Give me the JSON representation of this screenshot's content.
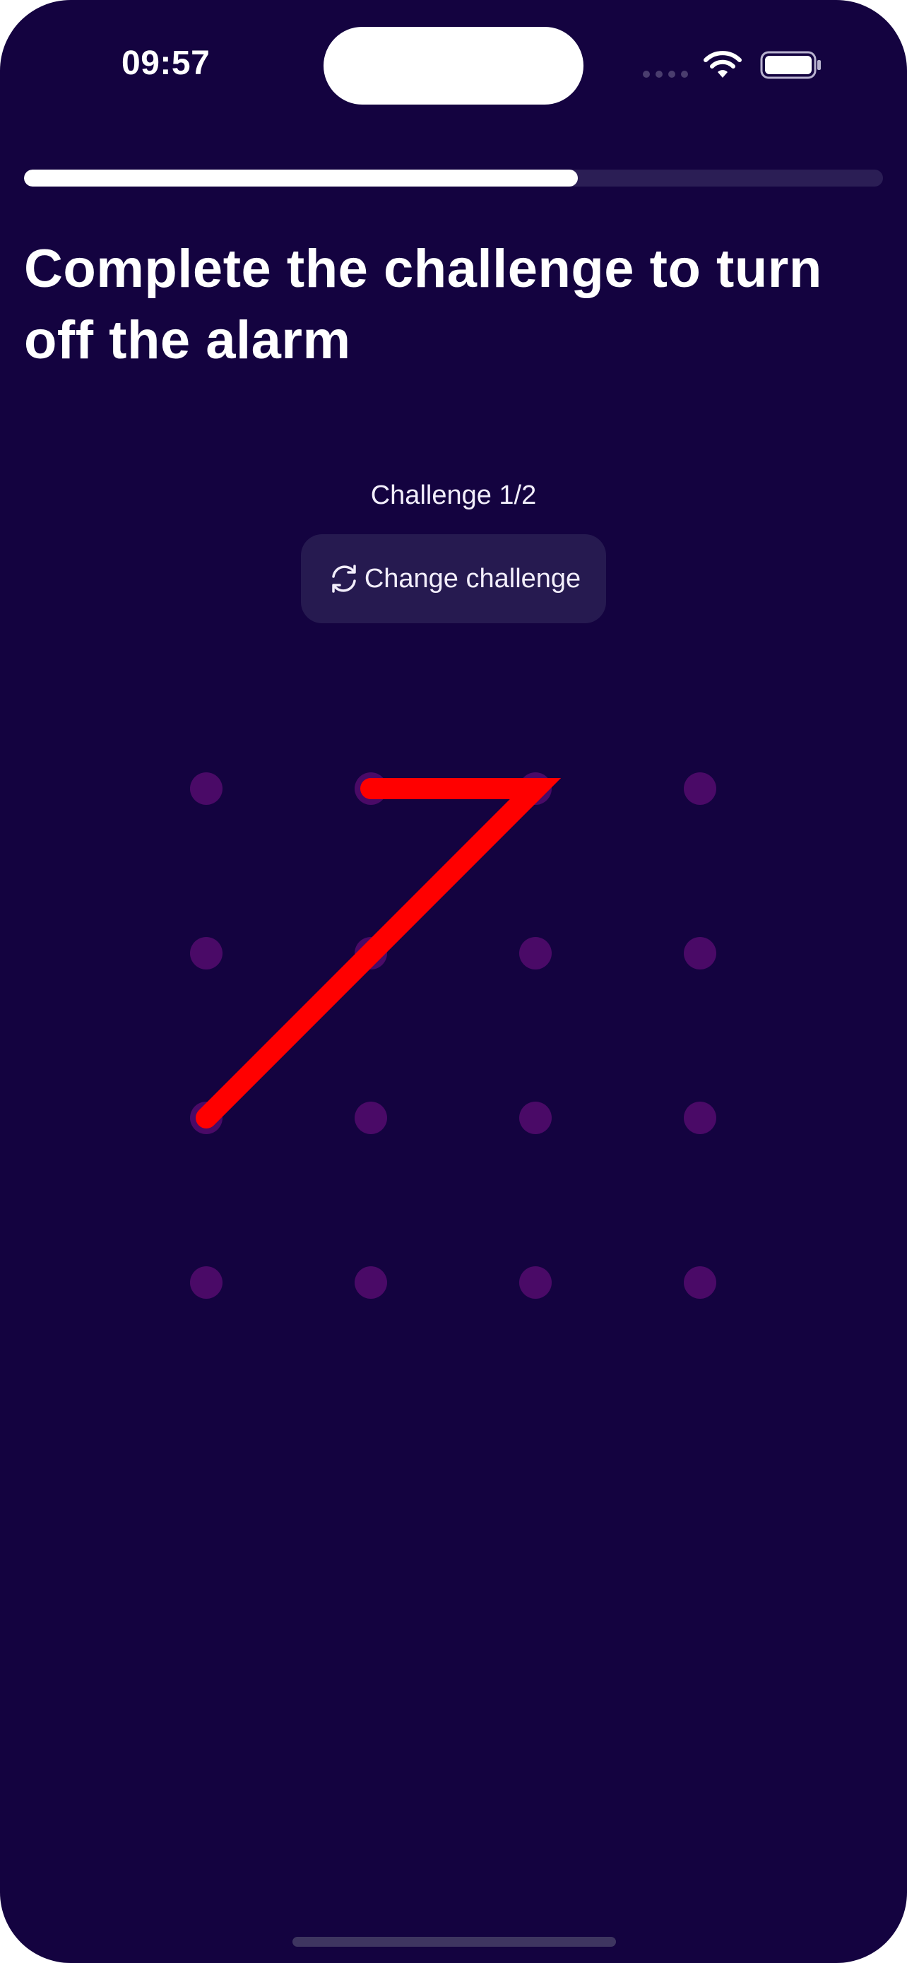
{
  "status_bar": {
    "time": "09:57"
  },
  "progress": {
    "fraction": 0.645
  },
  "title": "Complete the challenge to turn off the alarm",
  "challenge": {
    "counter": "Challenge 1/2",
    "change_label": "Change challenge",
    "change_icon": "refresh-icon"
  },
  "pattern": {
    "rows": 4,
    "cols": 4,
    "dot_color": "#4a0a67",
    "line_color": "#ff0000",
    "path": [
      [
        1,
        0
      ],
      [
        2,
        0
      ],
      [
        1,
        1
      ],
      [
        0,
        2
      ]
    ]
  },
  "colors": {
    "background": "#140340",
    "button_background": "#261a50",
    "progress_track": "#2b1e55"
  }
}
